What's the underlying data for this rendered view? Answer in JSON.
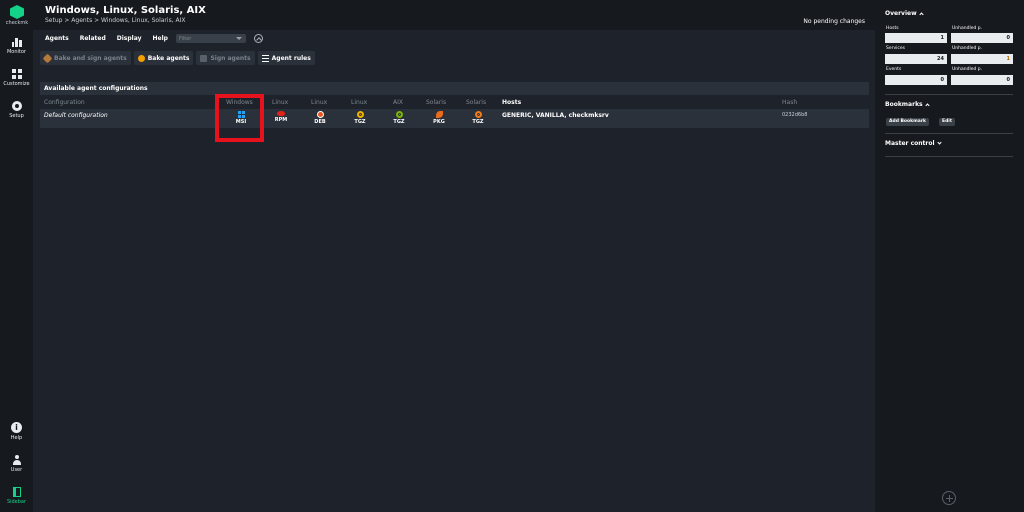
{
  "nav": {
    "logo_text": "checkmk",
    "monitor": "Monitor",
    "customize": "Customize",
    "setup": "Setup",
    "help": "Help",
    "user": "User",
    "sidebar": "Sidebar"
  },
  "header": {
    "title": "Windows, Linux, Solaris, AIX",
    "breadcrumb": "Setup > Agents > Windows, Linux, Solaris, AIX",
    "pending": "No pending changes"
  },
  "menu": {
    "agents": "Agents",
    "related": "Related",
    "display": "Display",
    "help": "Help",
    "filter_placeholder": "Filter"
  },
  "actions": {
    "bake_sign": "Bake and sign agents",
    "bake": "Bake agents",
    "sign": "Sign agents",
    "rules": "Agent rules"
  },
  "table": {
    "section_title": "Available agent configurations",
    "headers": {
      "configuration": "Configuration",
      "windows": "Windows",
      "linux1": "Linux",
      "linux2": "Linux",
      "linux3": "Linux",
      "aix": "AIX",
      "solaris1": "Solaris",
      "solaris2": "Solaris",
      "hosts": "Hosts",
      "hash": "Hash"
    },
    "row": {
      "configuration": "Default configuration",
      "msi": "MSI",
      "rpm": "RPM",
      "deb": "DEB",
      "tgz_linux": "TGZ",
      "tgz_aix": "TGZ",
      "pkg": "PKG",
      "tgz_solaris": "TGZ",
      "hosts": "GENERIC, VANILLA, checkmksrv",
      "hash": "0232d6b8"
    }
  },
  "sidebar": {
    "overview_title": "Overview",
    "hosts_label": "Hosts",
    "hosts_value": "1",
    "hosts_unhandled_label": "Unhandled p.",
    "hosts_unhandled_value": "0",
    "services_label": "Services",
    "services_value": "24",
    "services_unhandled_label": "Unhandled p.",
    "services_unhandled_value": "1",
    "events_label": "Events",
    "events_value": "0",
    "events_unhandled_label": "Unhandled p.",
    "events_unhandled_value": "0",
    "bookmarks_title": "Bookmarks",
    "add_bookmark": "Add Bookmark",
    "edit": "Edit",
    "master_title": "Master control"
  },
  "colors": {
    "accent": "#13d389",
    "highlight": "#e8121c",
    "background": "#1e232b"
  }
}
